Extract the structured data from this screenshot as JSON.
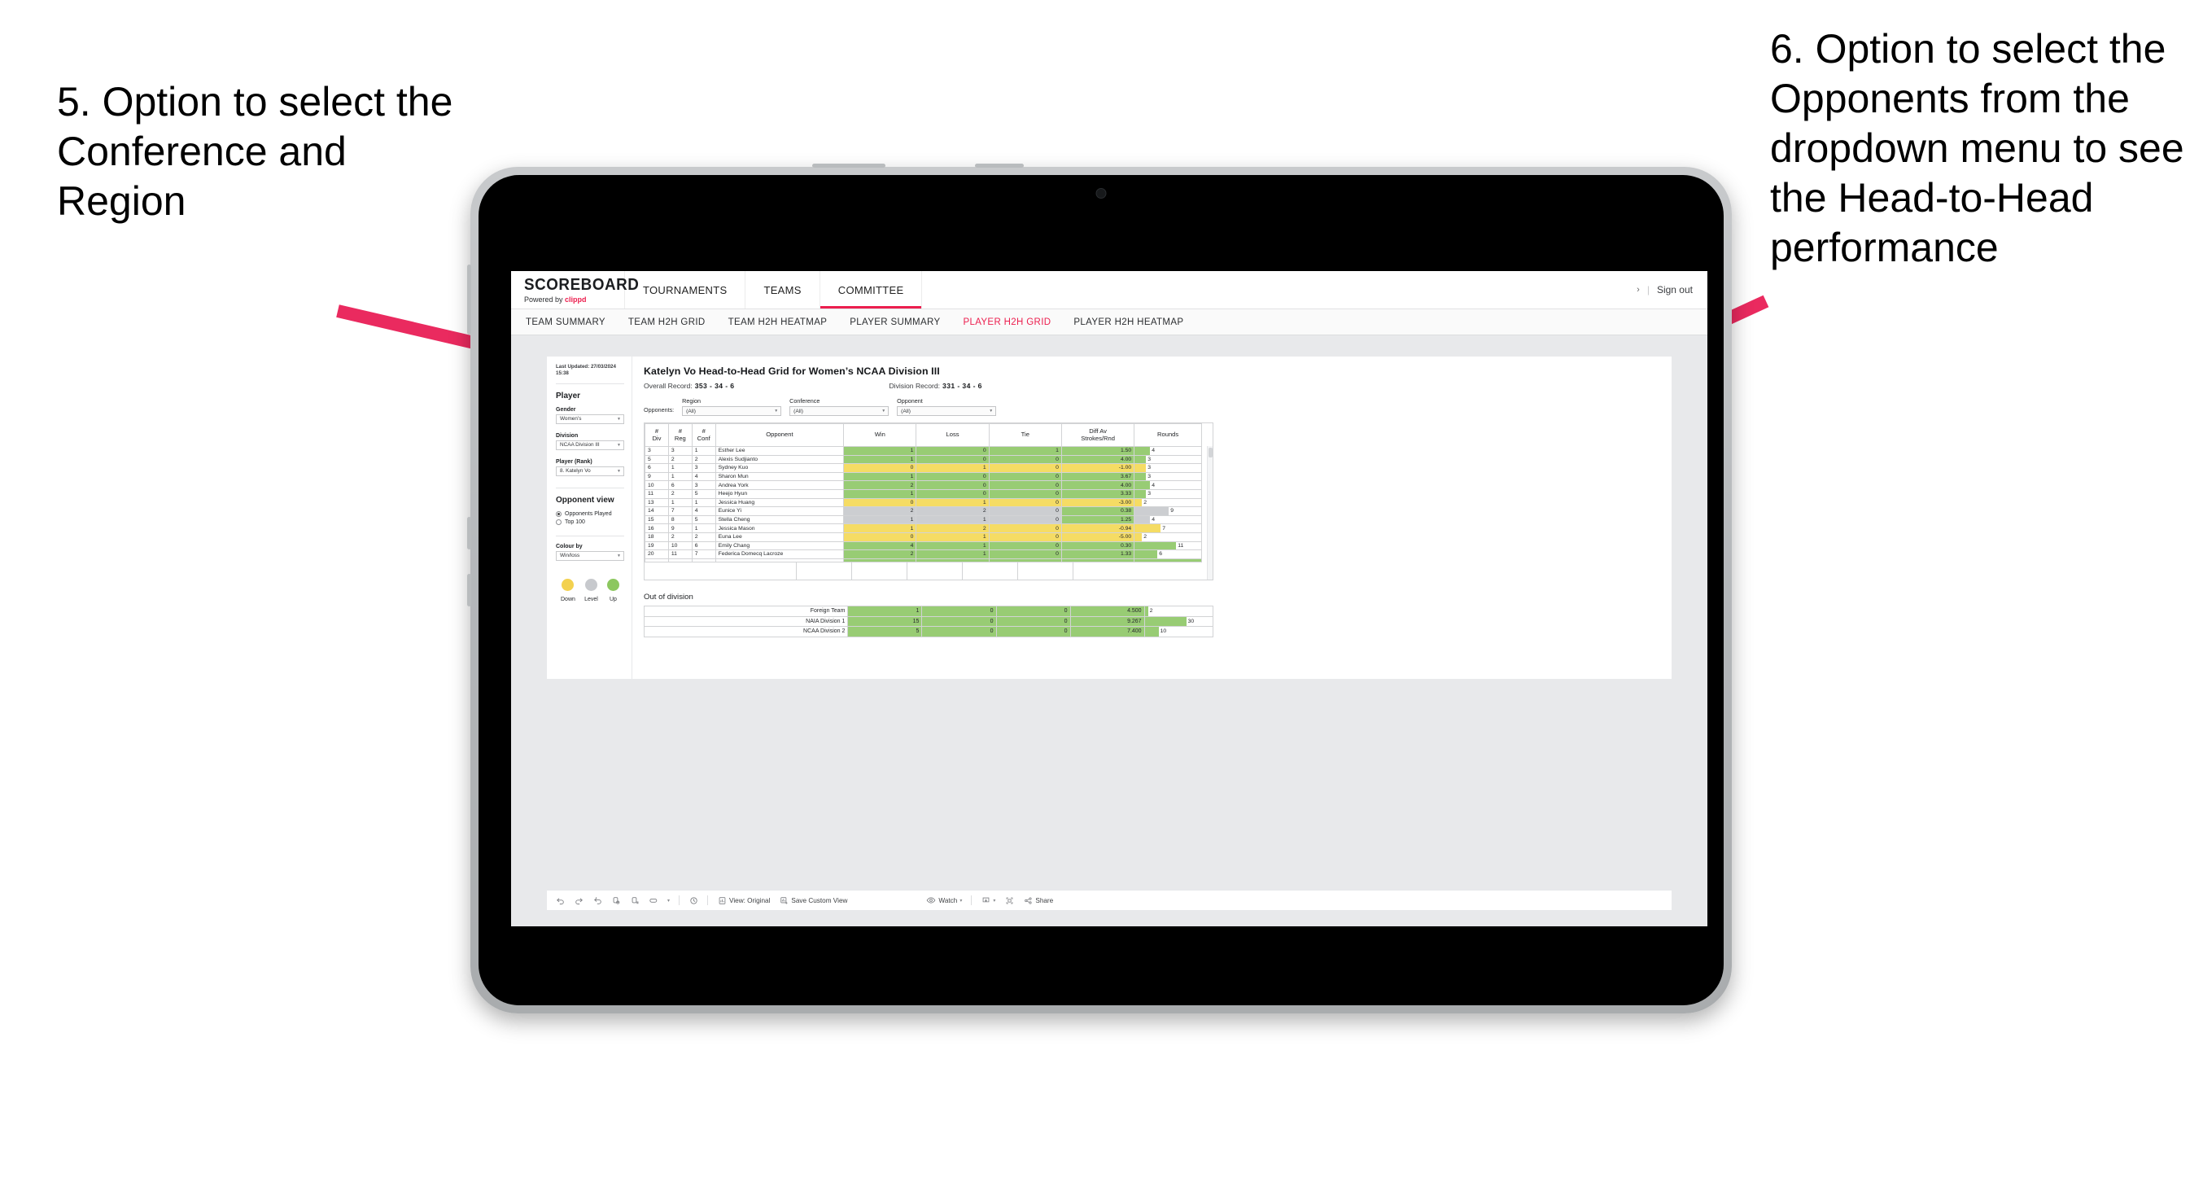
{
  "annotations": {
    "left": "5. Option to select the Conference and Region",
    "right": "6. Option to select the Opponents from the dropdown menu to see the Head-to-Head performance",
    "arrow_color": "#ea2a5f"
  },
  "app": {
    "brand": {
      "name": "SCOREBOARD",
      "powered_prefix": "Powered by ",
      "powered_brand": "clippd"
    },
    "topnav": [
      {
        "label": "TOURNAMENTS",
        "active": false
      },
      {
        "label": "TEAMS",
        "active": false
      },
      {
        "label": "COMMITTEE",
        "active": true
      }
    ],
    "topbar_right": {
      "chevron": "›",
      "separator": "|",
      "signout": "Sign out"
    },
    "subnav": [
      {
        "label": "TEAM SUMMARY",
        "active": false
      },
      {
        "label": "TEAM H2H GRID",
        "active": false
      },
      {
        "label": "TEAM H2H HEATMAP",
        "active": false
      },
      {
        "label": "PLAYER SUMMARY",
        "active": false
      },
      {
        "label": "PLAYER H2H GRID",
        "active": true
      },
      {
        "label": "PLAYER H2H HEATMAP",
        "active": false
      }
    ]
  },
  "sidebar": {
    "last_updated": "Last Updated: 27/03/2024 15:38",
    "player_section_title": "Player",
    "gender": {
      "label": "Gender",
      "value": "Women’s"
    },
    "division": {
      "label": "Division",
      "value": "NCAA Division III"
    },
    "player_rank": {
      "label": "Player (Rank)",
      "value": "8. Katelyn Vo"
    },
    "opponent_view": {
      "title": "Opponent view",
      "options": [
        {
          "label": "Opponents Played",
          "selected": true
        },
        {
          "label": "Top 100",
          "selected": false
        }
      ]
    },
    "colour_by": {
      "label": "Colour by",
      "value": "Win/loss"
    },
    "legend": [
      {
        "caption": "Down",
        "color": "#f3d14f"
      },
      {
        "caption": "Level",
        "color": "#c7c9cd"
      },
      {
        "caption": "Up",
        "color": "#8cc75f"
      }
    ]
  },
  "viz": {
    "title": "Katelyn Vo Head-to-Head Grid for Women’s NCAA Division III",
    "overall_record": {
      "label": "Overall Record:",
      "value": "353 -  34 - 6"
    },
    "division_record": {
      "label": "Division Record:",
      "value": "331 -  34 - 6"
    },
    "opponents_label": "Opponents:",
    "filters": [
      {
        "label": "Region",
        "value": "(All)"
      },
      {
        "label": "Conference",
        "value": "(All)"
      },
      {
        "label": "Opponent",
        "value": "(All)"
      }
    ]
  },
  "chart_data": {
    "type": "table",
    "title": "Katelyn Vo Head-to-Head Grid for Women’s NCAA Division III",
    "columns": [
      "# Div",
      "# Reg",
      "# Conf",
      "Opponent",
      "Win",
      "Loss",
      "Tie",
      "Diff Av Strokes/Rnd",
      "Rounds"
    ],
    "column_header_lines": [
      [
        "#",
        "Div"
      ],
      [
        "#",
        "Reg"
      ],
      [
        "#",
        "Conf"
      ],
      [
        "Opponent"
      ],
      [
        "Win"
      ],
      [
        "Loss"
      ],
      [
        "Tie"
      ],
      [
        "Diff Av",
        "Strokes/Rnd"
      ],
      [
        "Rounds"
      ]
    ],
    "colors": {
      "up": "#98cc74",
      "down": "#f5dc64",
      "level": "#ccced1"
    },
    "rounds_max": 11,
    "rows": [
      {
        "div": "3",
        "reg": "3",
        "conf": "1",
        "opponent": "Esther Lee",
        "win": "1",
        "loss": "0",
        "tie": "1",
        "diff": "1.50",
        "rounds": 4,
        "state": "up"
      },
      {
        "div": "5",
        "reg": "2",
        "conf": "2",
        "opponent": "Alexis Sudjianto",
        "win": "1",
        "loss": "0",
        "tie": "0",
        "diff": "4.00",
        "rounds": 3,
        "state": "up"
      },
      {
        "div": "6",
        "reg": "1",
        "conf": "3",
        "opponent": "Sydney Kuo",
        "win": "0",
        "loss": "1",
        "tie": "0",
        "diff": "-1.00",
        "rounds": 3,
        "state": "down"
      },
      {
        "div": "9",
        "reg": "1",
        "conf": "4",
        "opponent": "Sharon Mun",
        "win": "1",
        "loss": "0",
        "tie": "0",
        "diff": "3.67",
        "rounds": 3,
        "state": "up"
      },
      {
        "div": "10",
        "reg": "6",
        "conf": "3",
        "opponent": "Andrea York",
        "win": "2",
        "loss": "0",
        "tie": "0",
        "diff": "4.00",
        "rounds": 4,
        "state": "up"
      },
      {
        "div": "11",
        "reg": "2",
        "conf": "5",
        "opponent": "Heejo Hyun",
        "win": "1",
        "loss": "0",
        "tie": "0",
        "diff": "3.33",
        "rounds": 3,
        "state": "up"
      },
      {
        "div": "13",
        "reg": "1",
        "conf": "1",
        "opponent": "Jessica Huang",
        "win": "0",
        "loss": "1",
        "tie": "0",
        "diff": "-3.00",
        "rounds": 2,
        "state": "down"
      },
      {
        "div": "14",
        "reg": "7",
        "conf": "4",
        "opponent": "Eunice Yi",
        "win": "2",
        "loss": "2",
        "tie": "0",
        "diff": "0.38",
        "rounds": 9,
        "state": "level",
        "diff_state": "up"
      },
      {
        "div": "15",
        "reg": "8",
        "conf": "5",
        "opponent": "Stella Cheng",
        "win": "1",
        "loss": "1",
        "tie": "0",
        "diff": "1.25",
        "rounds": 4,
        "state": "level",
        "diff_state": "up"
      },
      {
        "div": "16",
        "reg": "9",
        "conf": "1",
        "opponent": "Jessica Mason",
        "win": "1",
        "loss": "2",
        "tie": "0",
        "diff": "-0.94",
        "rounds": 7,
        "state": "down"
      },
      {
        "div": "18",
        "reg": "2",
        "conf": "2",
        "opponent": "Euna Lee",
        "win": "0",
        "loss": "1",
        "tie": "0",
        "diff": "-5.00",
        "rounds": 2,
        "state": "down"
      },
      {
        "div": "19",
        "reg": "10",
        "conf": "6",
        "opponent": "Emily Chang",
        "win": "4",
        "loss": "1",
        "tie": "0",
        "diff": "0.30",
        "rounds": 11,
        "state": "up"
      },
      {
        "div": "20",
        "reg": "11",
        "conf": "7",
        "opponent": "Federica Domecq Lacroze",
        "win": "2",
        "loss": "1",
        "tie": "0",
        "diff": "1.33",
        "rounds": 6,
        "state": "up"
      }
    ]
  },
  "out_of_division": {
    "title": "Out of division",
    "rounds_max": 30,
    "rows": [
      {
        "name": "Foreign Team",
        "win": "1",
        "loss": "0",
        "tie": "0",
        "diff": "4.500",
        "rounds": 2,
        "state": "up"
      },
      {
        "name": "NAIA Division 1",
        "win": "15",
        "loss": "0",
        "tie": "0",
        "diff": "9.267",
        "rounds": 30,
        "state": "up"
      },
      {
        "name": "NCAA Division 2",
        "win": "5",
        "loss": "0",
        "tie": "0",
        "diff": "7.400",
        "rounds": 10,
        "state": "up"
      }
    ]
  },
  "toolbar": {
    "icons": [
      "undo-icon",
      "redo-icon",
      "revert-icon",
      "refresh-icon",
      "pause-icon",
      "loop-icon"
    ],
    "view_label": "View: Original",
    "save_custom_view_label": "Save Custom View",
    "watch_label": "Watch",
    "share_label": "Share",
    "caret": "▾"
  }
}
